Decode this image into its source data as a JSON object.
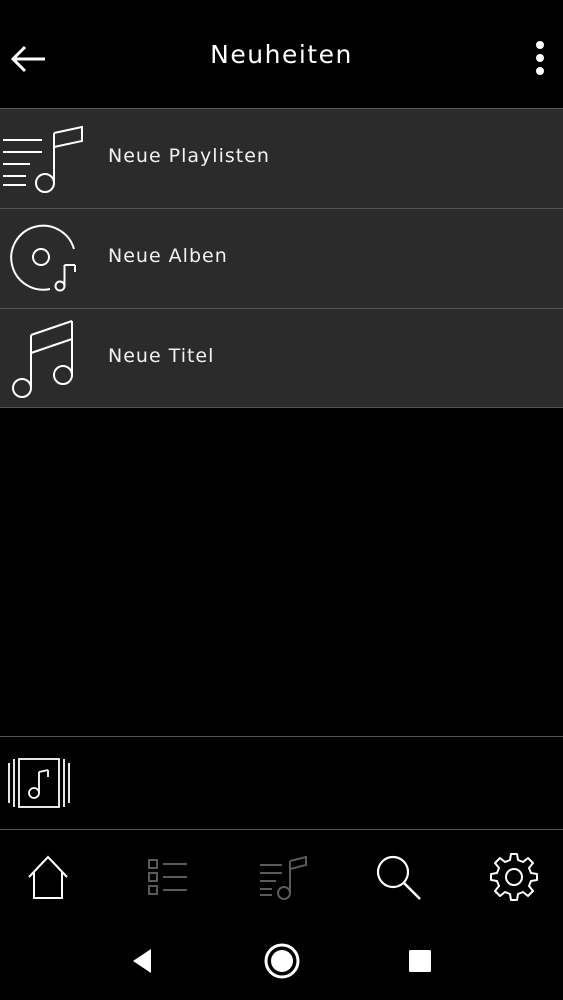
{
  "header": {
    "title": "Neuheiten",
    "back_icon": "arrow-left-icon",
    "menu_icon": "more-vertical-icon"
  },
  "list": {
    "items": [
      {
        "label": "Neue Playlisten",
        "icon": "playlist-icon"
      },
      {
        "label": "Neue Alben",
        "icon": "album-disc-icon"
      },
      {
        "label": "Neue Titel",
        "icon": "music-notes-icon"
      }
    ]
  },
  "mini_player": {
    "icon": "music-note-frame-icon"
  },
  "bottom_nav": {
    "items": [
      {
        "icon": "home-icon",
        "active": true
      },
      {
        "icon": "queue-list-icon",
        "active": false
      },
      {
        "icon": "now-playing-icon",
        "active": false
      },
      {
        "icon": "search-icon",
        "active": true
      },
      {
        "icon": "gear-icon",
        "active": true
      }
    ]
  },
  "system_nav": {
    "back": "triangle-back-icon",
    "home": "circle-home-icon",
    "recents": "square-recents-icon"
  },
  "colors": {
    "background": "#000000",
    "row_background": "#2b2b2b",
    "divider": "#555555",
    "text": "#ffffff",
    "inactive_icon": "#5a5a5a"
  }
}
